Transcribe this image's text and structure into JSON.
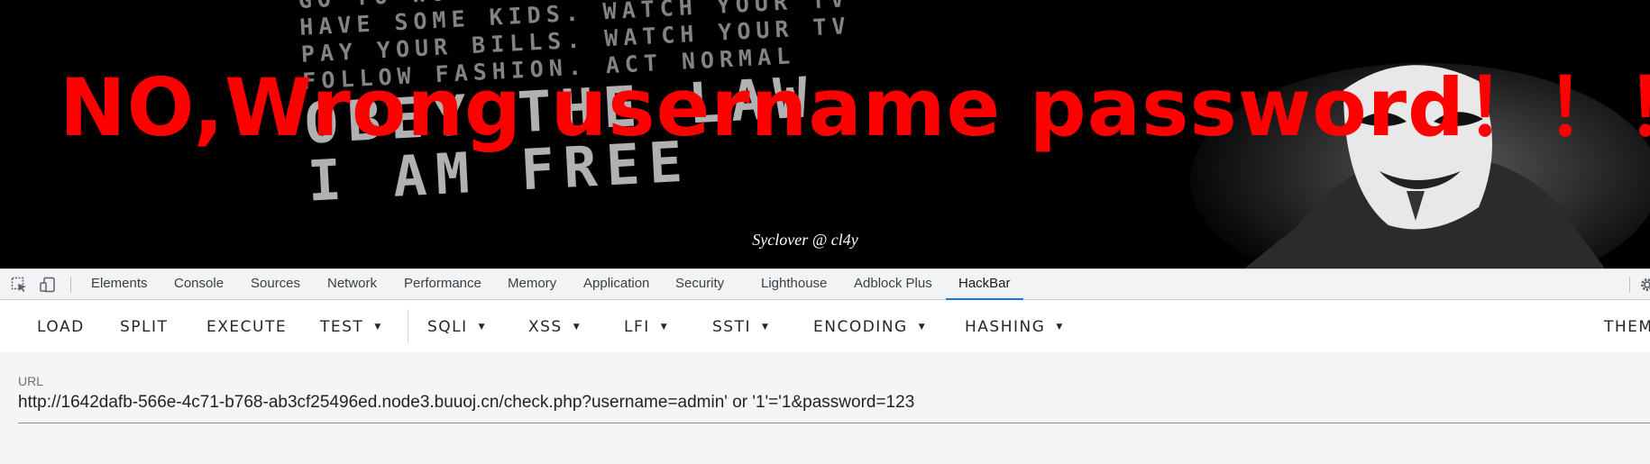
{
  "page": {
    "background_text_lines": [
      "GO TO WORK. PAY YOUR TAXES",
      "HAVE SOME KIDS. WATCH YOUR TV",
      "PAY YOUR BILLS. WATCH YOUR TV",
      "FOLLOW FASHION. ACT NORMAL"
    ],
    "background_big_lines": [
      "OBEY THE LAW",
      "I AM FREE"
    ],
    "headline": "NO,Wrong username password！！！",
    "headline_color": "#ff0000",
    "credit": "Syclover @ cl4y"
  },
  "devtools": {
    "icons": [
      "inspect-element-icon",
      "device-toolbar-icon",
      "settings-gear-icon"
    ],
    "tabs": [
      "Elements",
      "Console",
      "Sources",
      "Network",
      "Performance",
      "Memory",
      "Application",
      "Security",
      "Lighthouse",
      "Adblock Plus",
      "HackBar"
    ],
    "active_tab": "HackBar",
    "accent_color": "#1a73e8"
  },
  "hackbar": {
    "buttons": {
      "load": "LOAD",
      "split": "SPLIT",
      "execute": "EXECUTE",
      "test": "TEST",
      "sqli": "SQLI",
      "xss": "XSS",
      "lfi": "LFI",
      "ssti": "SSTI",
      "encoding": "ENCODING",
      "hashing": "HASHING",
      "theme": "THEM"
    },
    "url_label": "URL",
    "url_value": "http://1642dafb-566e-4c71-b768-ab3cf25496ed.node3.buuoj.cn/check.php?username=admin' or '1'='1&password=123"
  }
}
